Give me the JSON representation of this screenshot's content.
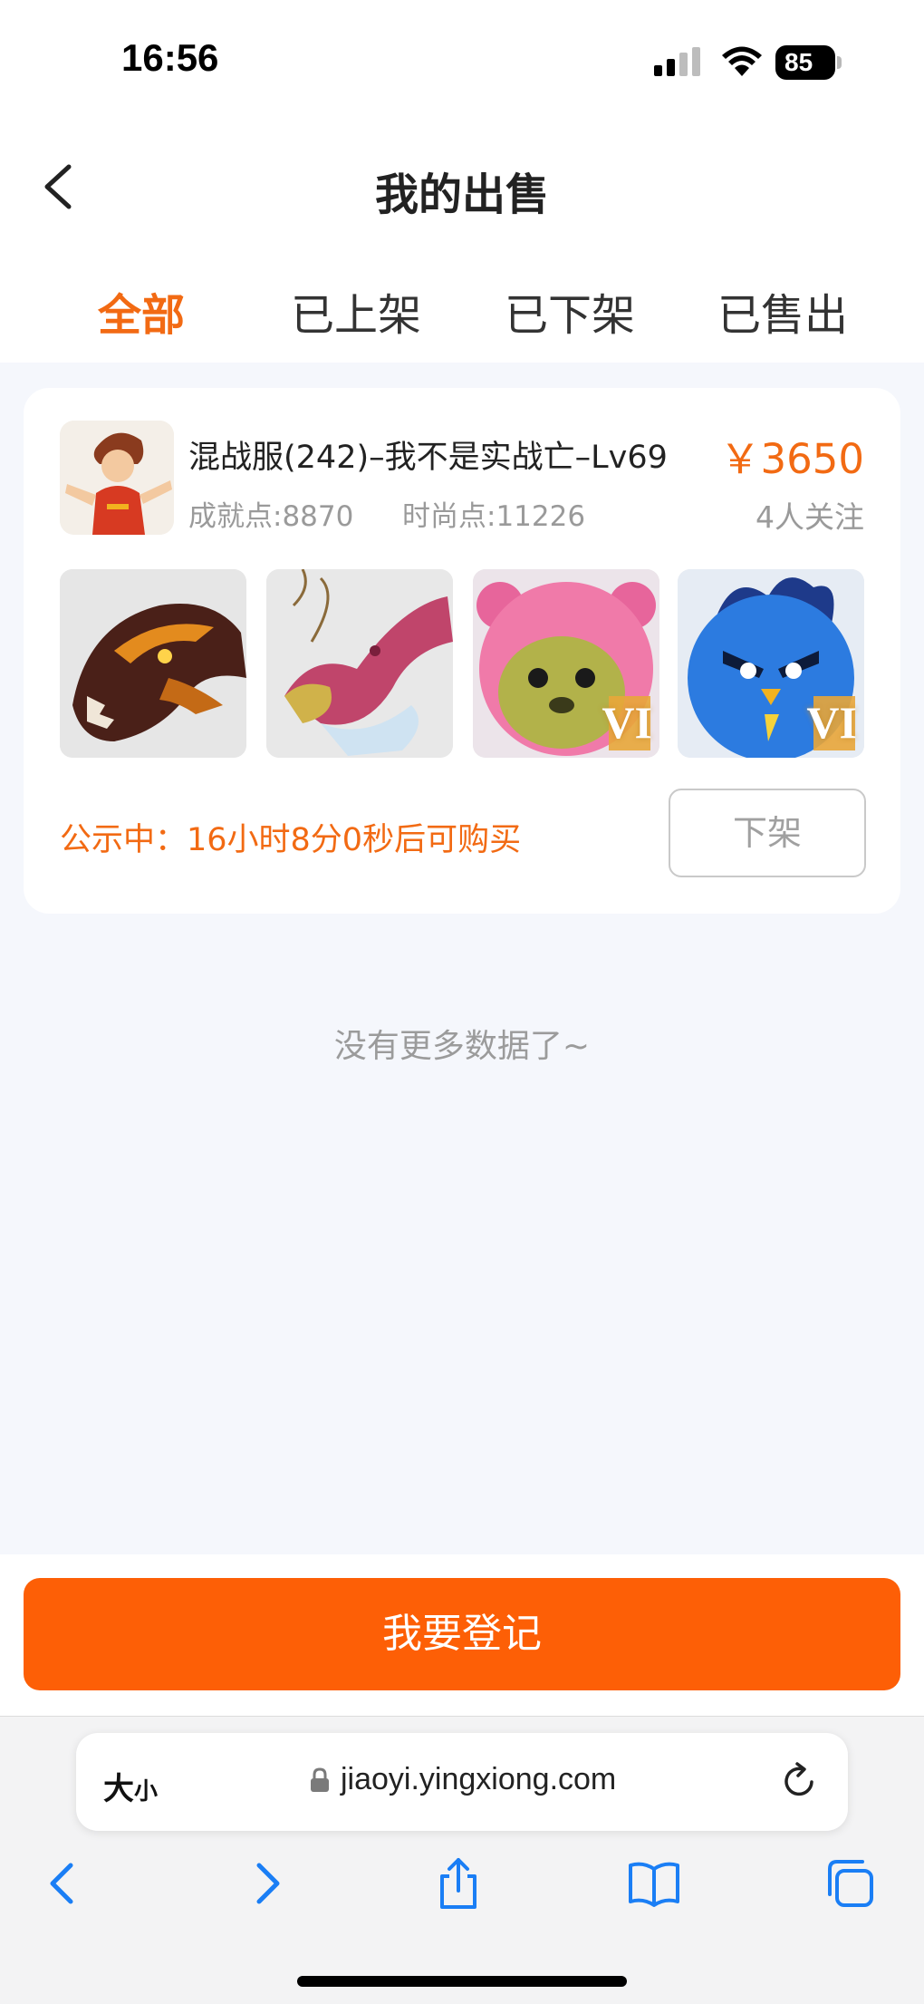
{
  "status_bar": {
    "time": "16:56",
    "battery": "85"
  },
  "header": {
    "title": "我的出售"
  },
  "tabs": [
    {
      "label": "全部",
      "active": true
    },
    {
      "label": "已上架",
      "active": false
    },
    {
      "label": "已下架",
      "active": false
    },
    {
      "label": "已售出",
      "active": false
    }
  ],
  "listing": {
    "title": "混战服(242)–我不是实战亡–Lv69",
    "price": "￥3650",
    "achievement": "成就点:8870",
    "fashion": "时尚点:11226",
    "followers": "4人关注",
    "badges": [
      "VI",
      "VI"
    ],
    "notice": "公示中：16小时8分0秒后可购买",
    "delist_label": "下架"
  },
  "no_more_text": "没有更多数据了~",
  "register_button": "我要登记",
  "browser": {
    "aa_big": "大",
    "aa_small": "小",
    "url": "jiaoyi.yingxiong.com"
  },
  "colors": {
    "accent": "#f26a13",
    "button": "#fd5f06",
    "ios_blue": "#1a7ef5"
  }
}
